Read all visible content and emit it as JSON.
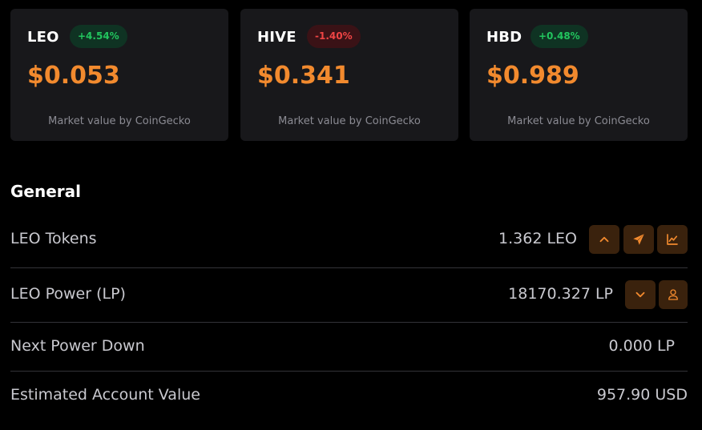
{
  "cards": [
    {
      "symbol": "LEO",
      "change": "+4.54%",
      "direction": "up",
      "price": "$0.053",
      "source": "Market value by CoinGecko"
    },
    {
      "symbol": "HIVE",
      "change": "-1.40%",
      "direction": "down",
      "price": "$0.341",
      "source": "Market value by CoinGecko"
    },
    {
      "symbol": "HBD",
      "change": "+0.48%",
      "direction": "up",
      "price": "$0.989",
      "source": "Market value by CoinGecko"
    }
  ],
  "general": {
    "title": "General",
    "rows": [
      {
        "label": "LEO Tokens",
        "value": "1.362 LEO",
        "actions": [
          "chevron-up-icon",
          "send-icon",
          "chart-line-icon"
        ]
      },
      {
        "label": "LEO Power (LP)",
        "value": "18170.327 LP",
        "actions": [
          "chevron-down-icon",
          "user-icon"
        ]
      },
      {
        "label": "Next Power Down",
        "value": "0.000 LP"
      },
      {
        "label": "Estimated Account Value",
        "value": "957.90 USD"
      }
    ]
  },
  "colors": {
    "accent": "#f28a2e",
    "positive": "#22c55e",
    "negative": "#ef4444",
    "card_bg": "#18181b",
    "button_bg": "#3a220d"
  }
}
